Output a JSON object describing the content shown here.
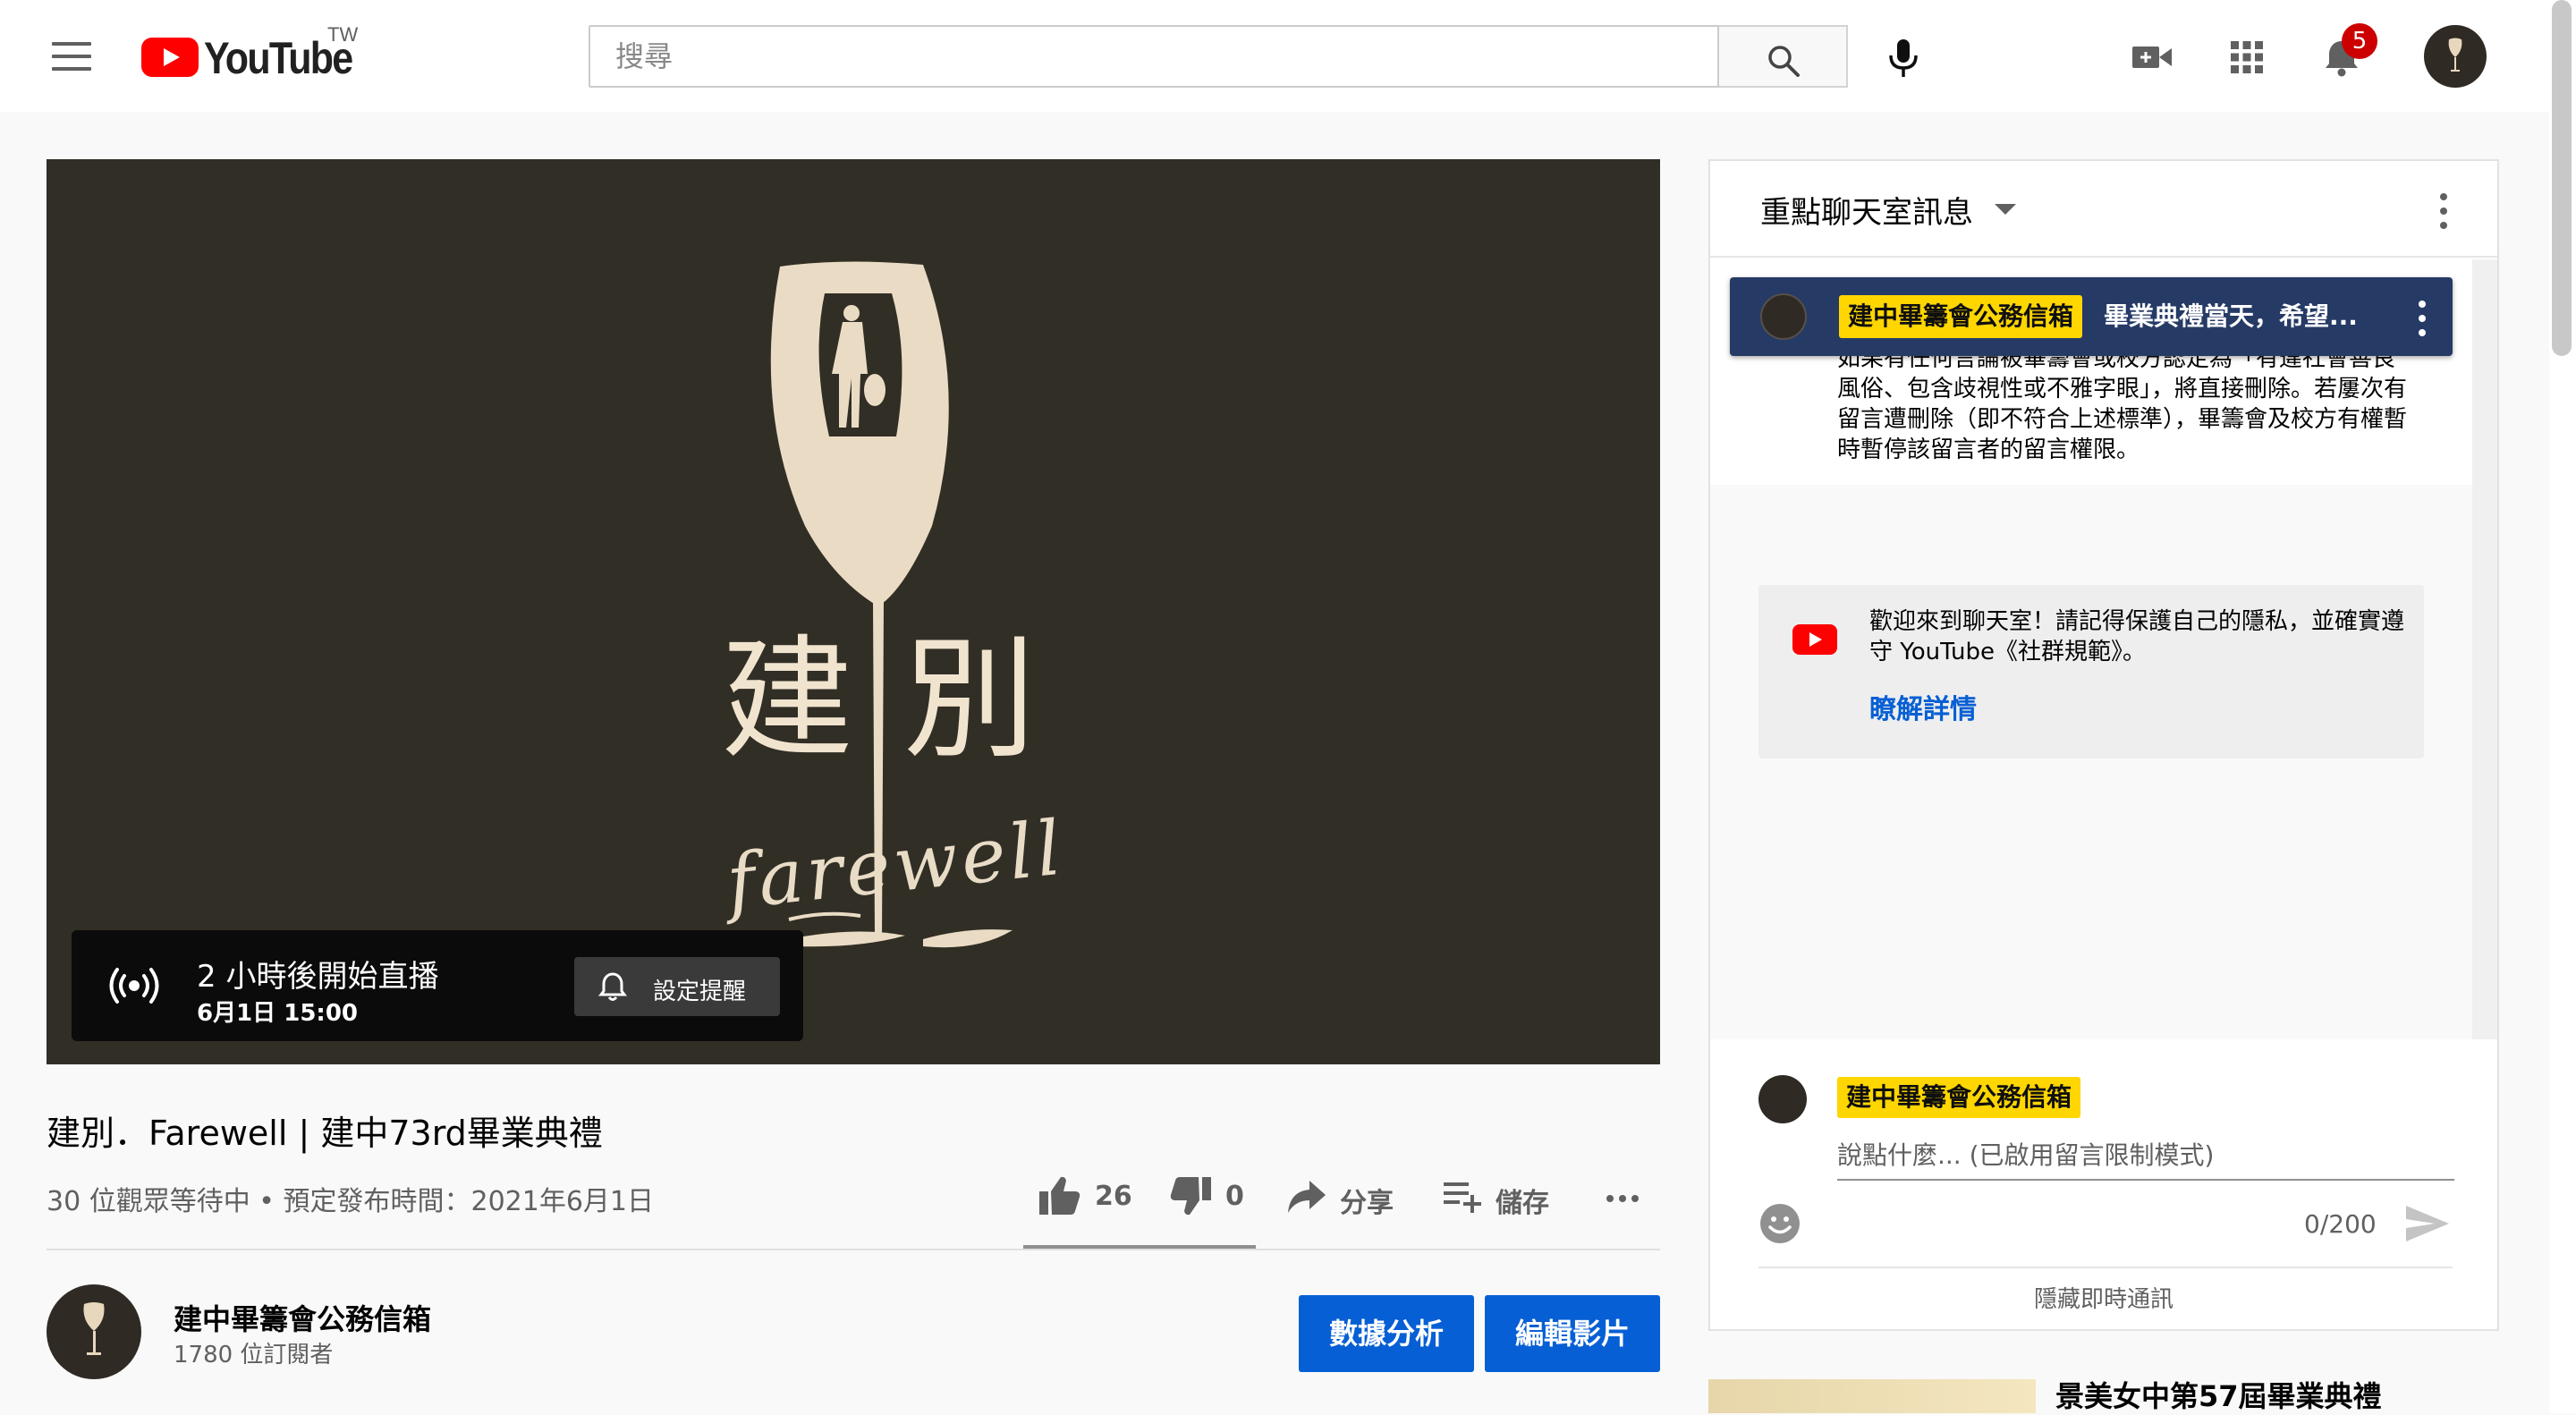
{
  "masthead": {
    "logo_text": "YouTube",
    "region": "TW",
    "search_placeholder": "搜尋",
    "notification_count": "5",
    "icons": [
      "menu-icon",
      "search-icon",
      "mic-icon",
      "create-video-icon",
      "apps-grid-icon",
      "bell-icon"
    ]
  },
  "player": {
    "art_title_left": "建",
    "art_title_right": "別",
    "art_script": "farewell",
    "live_status": "2 小時後開始直播",
    "live_time": "6月1日 15:00",
    "reminder_label": "設定提醒",
    "colors": {
      "background": "#312e26",
      "art": "#eadcc4"
    }
  },
  "video": {
    "title": "建別．Farewell | 建中73rd畢業典禮",
    "meta": "30 位觀眾等待中 • 預定發布時間：2021年6月1日",
    "likes": "26",
    "dislikes": "0",
    "share_label": "分享",
    "save_label": "儲存"
  },
  "owner": {
    "name": "建中畢籌會公務信箱",
    "subscribers": "1780 位訂閱者",
    "analytics_label": "數據分析",
    "edit_label": "編輯影片",
    "accent": "#065fd4"
  },
  "chat": {
    "title": "重點聊天室訊息",
    "pinned_author": "建中畢籌會公務信箱",
    "pinned_message": "畢業典禮當天，希望...",
    "rules_text": "如果有任何言論被畢籌會或校方認定為「有違社會善良風俗、包含歧視性或不雅字眼」，將直接刪除。若屢次有留言遭刪除（即不符合上述標準），畢籌會及校方有權暫時暫停該留言者的留言權限。",
    "welcome_text": "歡迎來到聊天室！請記得保護自己的隱私，並確實遵守 YouTube《社群規範》。",
    "learn_more": "瞭解詳情",
    "composer_author": "建中畢籌會公務信箱",
    "composer_placeholder": "說點什麼... (已啟用留言限制模式)",
    "char_counter": "0/200",
    "hide_chat": "隱藏即時通訊",
    "pinned_bg": "#263a66",
    "owner_chip": "#ffd600"
  },
  "recommended": {
    "title": "景美女中第57屆畢業典禮"
  }
}
